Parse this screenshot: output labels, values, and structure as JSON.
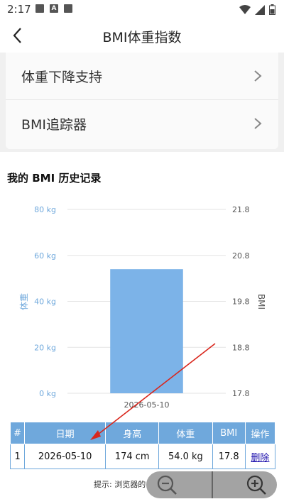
{
  "status": {
    "time": "2:17",
    "icon_a": "A"
  },
  "header": {
    "title": "BMI体重指数"
  },
  "menu": {
    "items": [
      {
        "label": "体重下降支持"
      },
      {
        "label": "BMI追踪器"
      }
    ]
  },
  "history": {
    "title": "我的 BMI 历史记录"
  },
  "chart_data": {
    "type": "bar",
    "categories": [
      "2026-05-10"
    ],
    "values": [
      54.0
    ],
    "ylabel": "体重",
    "y2label": "BMI",
    "ylim": [
      0,
      80
    ],
    "y2lim": [
      17.8,
      21.8
    ],
    "yticks": [
      "0 kg",
      "20 kg",
      "40 kg",
      "60 kg",
      "80 kg"
    ],
    "y2ticks": [
      "17.8",
      "18.8",
      "19.8",
      "20.8",
      "21.8"
    ],
    "bar_color": "#7cb3e8",
    "axis_label_color": "#6fa8dc"
  },
  "table": {
    "headers": [
      "#",
      "日期",
      "身高",
      "体重",
      "BMI",
      "操作"
    ],
    "rows": [
      [
        "1",
        "2026-05-10",
        "174 cm",
        "54.0 kg",
        "17.8",
        "删除"
      ]
    ]
  },
  "hint": {
    "text": "提示: 浏览器的"
  },
  "colors": {
    "header_bg": "#6fa8dc",
    "arrow": "#d9261c"
  }
}
